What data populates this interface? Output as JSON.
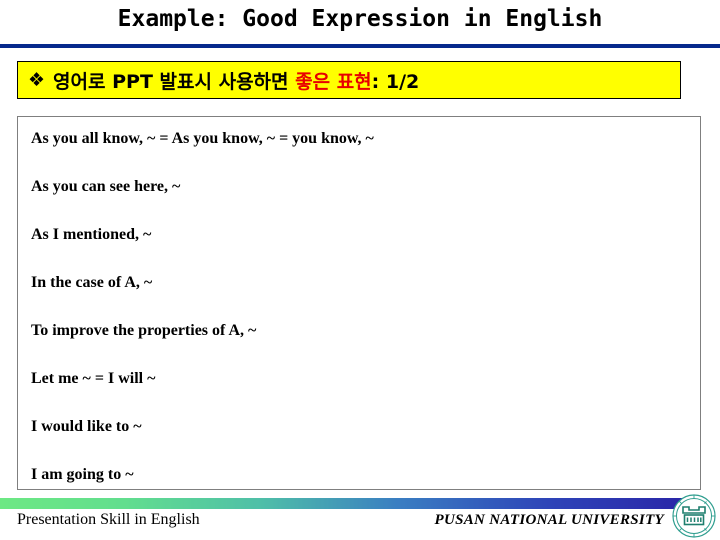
{
  "slide": {
    "title": "Example: Good Expression in English",
    "rule_color": "#06298C"
  },
  "banner": {
    "bullet_icon": "diamond-bullet-icon",
    "bullet_glyph": "❖",
    "text_before": "영어로 PPT  발표시 사용하면 ",
    "text_highlight": "좋은 표현",
    "text_after": ": 1/2",
    "background_color": "#FFFF00",
    "highlight_color": "#E80000",
    "border_color": "#000000"
  },
  "content": {
    "phrases": [
      "As you all know, ~  =  As you know, ~  =  you know, ~",
      "As you can see here,  ~",
      "As I mentioned,  ~",
      "In the case of A, ~",
      "To improve the properties of A, ~",
      "Let me ~  =  I will ~",
      "I would like to ~",
      "I am going to  ~"
    ],
    "border_color": "#7F7F7F"
  },
  "footer": {
    "left_text": "Presentation Skill in English",
    "right_text": "PUSAN NATIONAL UNIVERSITY",
    "logo_icon": "pusan-national-university-seal-icon",
    "gradient_start_color": "#6DE884",
    "gradient_end_color": "#2A26A8"
  }
}
